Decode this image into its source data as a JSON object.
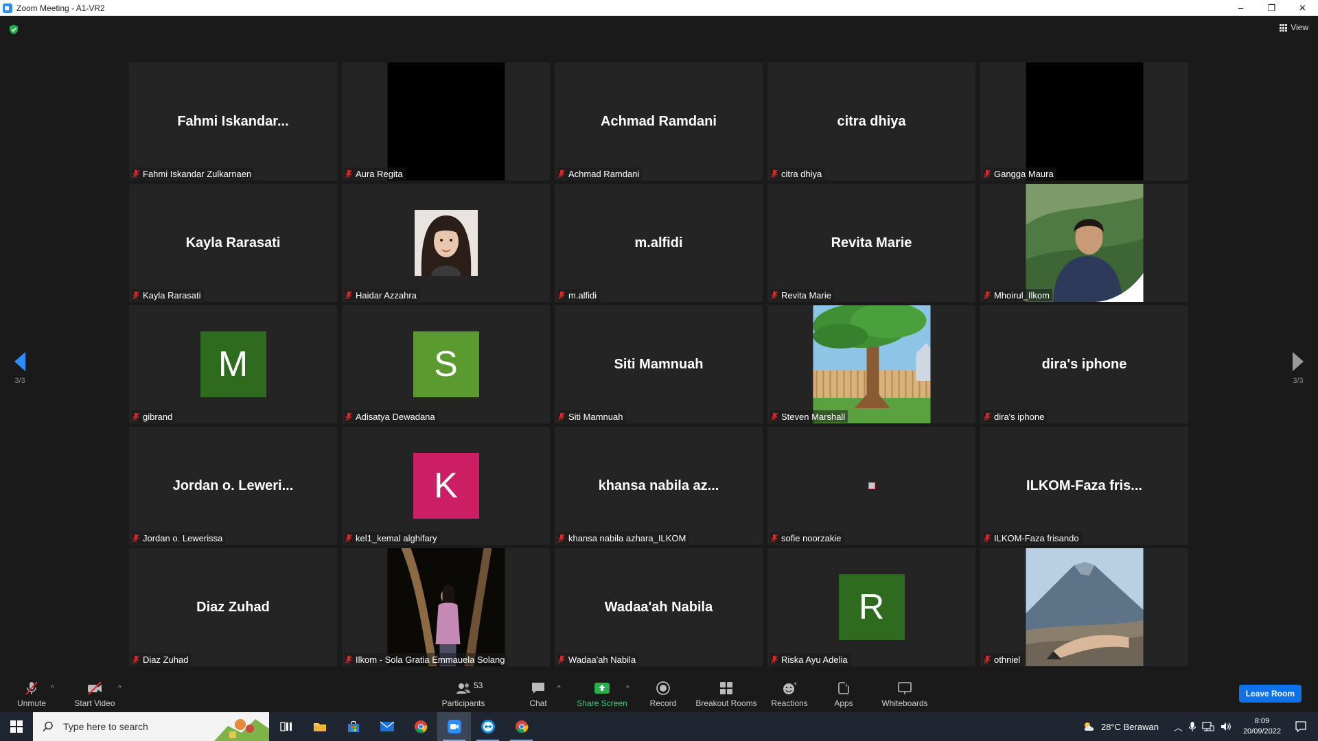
{
  "window": {
    "title": "Zoom Meeting - A1-VR2",
    "controls": [
      "–",
      "❐",
      "✕"
    ]
  },
  "top_bar": {
    "view_label": "View"
  },
  "pagination": {
    "left_page": "3/3",
    "right_page": "3/3"
  },
  "participants": [
    {
      "display": "Fahmi  Iskandar...",
      "name": "Fahmi Iskandar Zulkarnaen",
      "kind": "name"
    },
    {
      "display": "",
      "name": "Aura Regita",
      "kind": "black"
    },
    {
      "display": "Achmad Ramdani",
      "name": "Achmad Ramdani",
      "kind": "name"
    },
    {
      "display": "citra dhiya",
      "name": "citra dhiya",
      "kind": "name"
    },
    {
      "display": "",
      "name": "Gangga Maura",
      "kind": "black"
    },
    {
      "display": "Kayla Rarasati",
      "name": "Kayla Rarasati",
      "kind": "name"
    },
    {
      "display": "",
      "name": "Haidar Azzahra",
      "kind": "photo-girl"
    },
    {
      "display": "m.alfidi",
      "name": "m.alfidi",
      "kind": "name"
    },
    {
      "display": "Revita Marie",
      "name": "Revita Marie",
      "kind": "name"
    },
    {
      "display": "",
      "name": "Mhoirul_Ilkom",
      "kind": "photo-man"
    },
    {
      "display": "M",
      "name": "gibrand",
      "kind": "avatar",
      "color": "#2f6b1e"
    },
    {
      "display": "S",
      "name": "Adisatya Dewadana",
      "kind": "avatar",
      "color": "#5b9a2f"
    },
    {
      "display": "Siti Mamnuah",
      "name": "Siti Mamnuah",
      "kind": "name"
    },
    {
      "display": "",
      "name": "Steven Marshall",
      "kind": "photo-tree"
    },
    {
      "display": "dira's iphone",
      "name": "dira's iphone",
      "kind": "name"
    },
    {
      "display": "Jordan o. Leweri...",
      "name": "Jordan o. Lewerissa",
      "kind": "name"
    },
    {
      "display": "K",
      "name": "kel1_kemal alghifary",
      "kind": "avatar",
      "color": "#cc1e63"
    },
    {
      "display": "khansa nabila az...",
      "name": "khansa nabila azhara_ILKOM",
      "kind": "name"
    },
    {
      "display": "",
      "name": "sofie noorzakie",
      "kind": "tiny"
    },
    {
      "display": "ILKOM-Faza  fris...",
      "name": "ILKOM-Faza frisando",
      "kind": "name"
    },
    {
      "display": "Diaz Zuhad",
      "name": "Diaz Zuhad",
      "kind": "name"
    },
    {
      "display": "",
      "name": "Ilkom - Sola Gratia Emmauela Solang",
      "kind": "photo-night"
    },
    {
      "display": "Wadaa'ah Nabila",
      "name": "Wadaa'ah Nabila",
      "kind": "name"
    },
    {
      "display": "R",
      "name": "Riska Ayu Adelia",
      "kind": "avatar",
      "color": "#2f6b1e"
    },
    {
      "display": "",
      "name": "othniel",
      "kind": "photo-mountain"
    }
  ],
  "toolbar": {
    "unmute": "Unmute",
    "start_video": "Start Video",
    "participants": "Participants",
    "participants_count": "53",
    "chat": "Chat",
    "share_screen": "Share Screen",
    "record": "Record",
    "breakout_rooms": "Breakout Rooms",
    "reactions": "Reactions",
    "apps": "Apps",
    "whiteboards": "Whiteboards",
    "leave": "Leave Room"
  },
  "taskbar": {
    "search_placeholder": "Type here to search",
    "weather": "28°C  Berawan",
    "time": "8:09",
    "date": "20/09/2022"
  },
  "colors": {
    "accent": "#2D8CFF",
    "leave": "#0e72ed",
    "share": "#2fd37a",
    "mute_red": "#e02828"
  }
}
